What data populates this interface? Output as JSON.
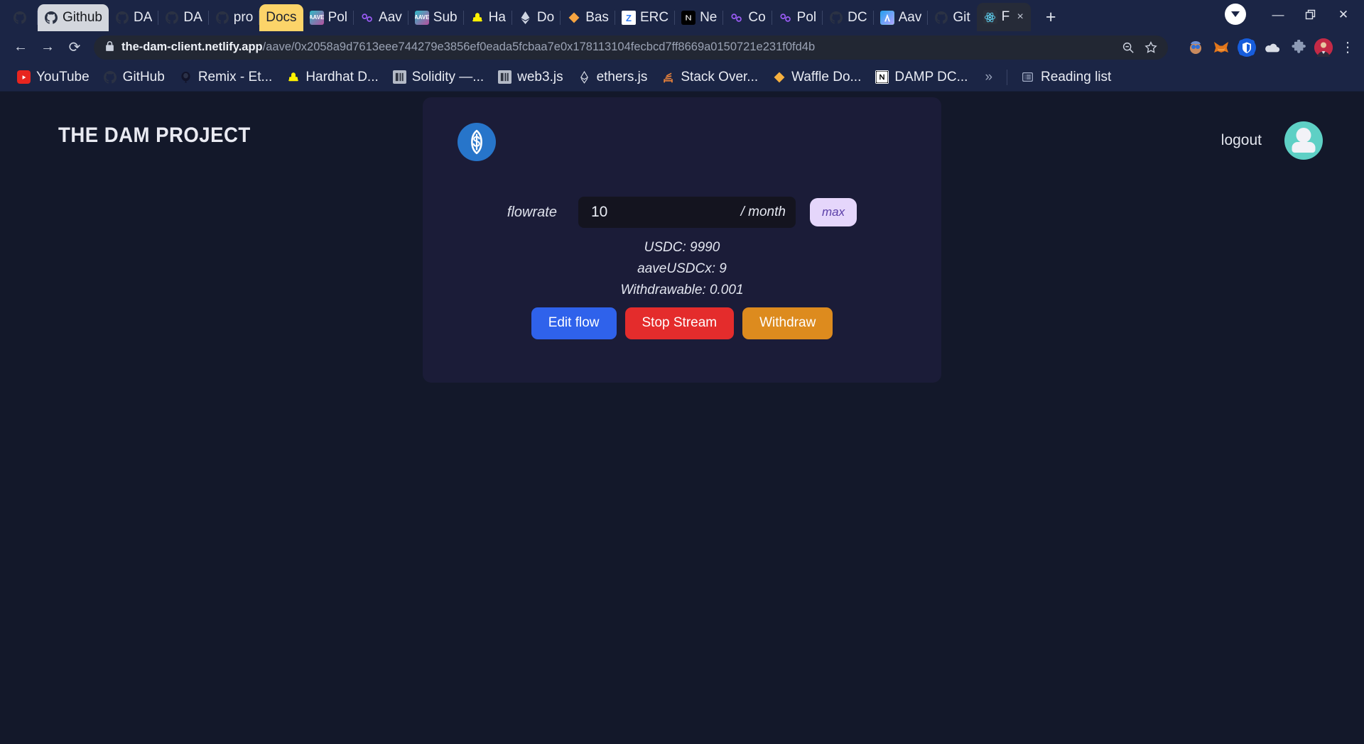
{
  "browser": {
    "tabs": [
      {
        "title": "",
        "icon": "github-icon",
        "style": "dark"
      },
      {
        "title": "Github",
        "icon": "github-icon",
        "style": "light"
      },
      {
        "title": "DA",
        "icon": "github-icon",
        "style": "dark"
      },
      {
        "title": "DA",
        "icon": "github-icon",
        "style": "dark"
      },
      {
        "title": "pro",
        "icon": "github-icon",
        "style": "dark"
      },
      {
        "title": "Docs",
        "icon": "docs-icon",
        "style": "yellow"
      },
      {
        "title": "Pol",
        "icon": "aave-icon",
        "style": "dark"
      },
      {
        "title": "Aav",
        "icon": "superfluid-icon",
        "style": "dark"
      },
      {
        "title": "Sub",
        "icon": "aave-icon",
        "style": "dark"
      },
      {
        "title": "Ha",
        "icon": "hardhat-icon",
        "style": "dark"
      },
      {
        "title": "Do",
        "icon": "ethers-icon",
        "style": "dark"
      },
      {
        "title": "Bas",
        "icon": "base-icon",
        "style": "dark"
      },
      {
        "title": "ERC",
        "icon": "erc-icon",
        "style": "dark"
      },
      {
        "title": "Ne",
        "icon": "nextjs-icon",
        "style": "dark"
      },
      {
        "title": "Co",
        "icon": "superfluid-icon",
        "style": "dark"
      },
      {
        "title": "Pol",
        "icon": "superfluid-icon",
        "style": "dark"
      },
      {
        "title": "DC",
        "icon": "github-icon",
        "style": "dark"
      },
      {
        "title": "Aav",
        "icon": "arbitrum-icon",
        "style": "dark"
      },
      {
        "title": "Git",
        "icon": "github-icon",
        "style": "dark"
      },
      {
        "title": "F",
        "icon": "react-icon",
        "style": "active"
      }
    ],
    "new_tab_label": "+",
    "tab_close_label": "×",
    "window_controls": {
      "minimize": "—",
      "maximize": "❐",
      "close": "✕"
    },
    "nav": {
      "back": "←",
      "forward": "→",
      "reload": "⟳"
    },
    "omnibox": {
      "lock_icon": "lock-icon",
      "url_host": "the-dam-client.netlify.app",
      "url_path": "/aave/0x2058a9d7613eee744279e3856ef0eada5fcbaa7e0x178113104fecbcd7ff8669a0150721e231f0fd4b",
      "zoom_icon": "zoom-out-icon",
      "bookmark_icon": "star-icon"
    },
    "extensions": [
      {
        "name": "rabby-extension-icon",
        "glyph": "🥽"
      },
      {
        "name": "metamask-extension-icon",
        "glyph": "🦊"
      },
      {
        "name": "bitwarden-extension-icon",
        "glyph": "🛡"
      },
      {
        "name": "cloud-extension-icon",
        "glyph": "☁"
      },
      {
        "name": "extensions-puzzle-icon",
        "glyph": "🧩"
      },
      {
        "name": "profile-avatar-icon",
        "glyph": "👨"
      }
    ],
    "menu_label": "⋮",
    "bookmarks": [
      {
        "label": "YouTube",
        "icon": "youtube-icon"
      },
      {
        "label": "GitHub",
        "icon": "github-icon"
      },
      {
        "label": "Remix - Et...",
        "icon": "remix-icon"
      },
      {
        "label": "Hardhat D...",
        "icon": "hardhat-icon"
      },
      {
        "label": "Solidity —...",
        "icon": "solidity-icon"
      },
      {
        "label": "web3.js",
        "icon": "web3-icon"
      },
      {
        "label": "ethers.js",
        "icon": "ethers-icon"
      },
      {
        "label": "Stack Over...",
        "icon": "stackoverflow-icon"
      },
      {
        "label": "Waffle Do...",
        "icon": "waffle-icon"
      },
      {
        "label": "DAMP DC...",
        "icon": "notion-icon"
      }
    ],
    "bookmarks_overflow": "»",
    "reading_list": {
      "label": "Reading list",
      "icon": "reading-list-icon"
    }
  },
  "app": {
    "title": "THE DAM PROJECT",
    "logout_label": "logout",
    "avatar_name": "user-avatar",
    "card": {
      "token_icon": "usdc-token-icon",
      "flowrate_label": "flowrate",
      "flowrate_value": "10",
      "flowrate_placeholder": "0",
      "flowrate_unit": "/ month",
      "max_label": "max",
      "balances": [
        "USDC: 9990",
        "aaveUSDCx: 9",
        "Withdrawable: 0.001"
      ],
      "buttons": {
        "edit": "Edit flow",
        "stop": "Stop Stream",
        "withdraw": "Withdraw"
      }
    }
  },
  "colors": {
    "chrome_bg": "#1b2545",
    "page_bg": "#13182a",
    "card_bg": "#1b1c38",
    "accent_blue": "#2f62eb",
    "accent_red": "#e42c2c",
    "accent_orange": "#dd8b1e",
    "max_bg": "#e5d6fb",
    "max_fg": "#5b3fa8",
    "usdc_blue": "#2775ca",
    "avatar_teal": "#5ed0c5"
  }
}
